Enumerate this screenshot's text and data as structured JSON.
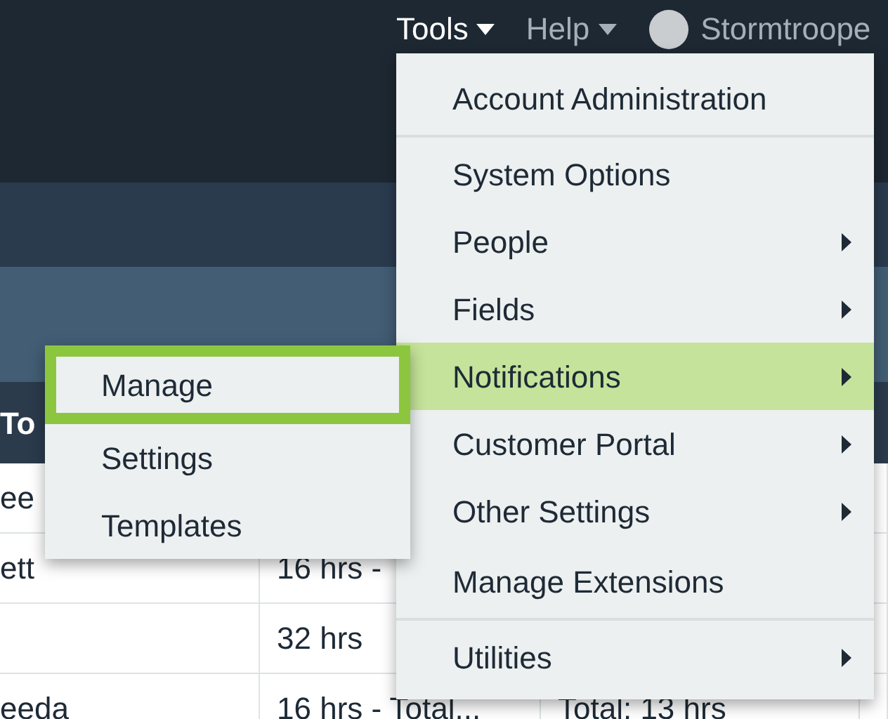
{
  "nav": {
    "items": [
      {
        "label": "Tools",
        "selected": true
      },
      {
        "label": "Help",
        "selected": false
      }
    ],
    "user": {
      "name": "Stormtroope"
    }
  },
  "table": {
    "columns": [
      "To"
    ],
    "rows": [
      [
        "ee",
        "",
        "",
        ""
      ],
      [
        "ett",
        "16 hrs -",
        "",
        ""
      ],
      [
        "",
        "32 hrs",
        "",
        ""
      ],
      [
        "eeda",
        "16 hrs - Total...",
        "Total: 13 hrs",
        ""
      ]
    ]
  },
  "tools_menu": {
    "items": [
      {
        "label": "Account Administration",
        "submenu": false,
        "divider_after": true,
        "selected": false
      },
      {
        "label": "System Options",
        "submenu": false,
        "divider_after": false,
        "selected": false
      },
      {
        "label": "People",
        "submenu": true,
        "divider_after": false,
        "selected": false
      },
      {
        "label": "Fields",
        "submenu": true,
        "divider_after": false,
        "selected": false
      },
      {
        "label": "Notifications",
        "submenu": true,
        "divider_after": false,
        "selected": true
      },
      {
        "label": "Customer Portal",
        "submenu": true,
        "divider_after": false,
        "selected": false
      },
      {
        "label": "Other Settings",
        "submenu": true,
        "divider_after": false,
        "selected": false
      },
      {
        "label": "Manage Extensions",
        "submenu": false,
        "divider_after": true,
        "selected": false
      },
      {
        "label": "Utilities",
        "submenu": true,
        "divider_after": false,
        "selected": false
      }
    ]
  },
  "submenu": {
    "items": [
      {
        "label": "Manage",
        "selected": true
      },
      {
        "label": "Settings",
        "selected": false
      },
      {
        "label": "Templates",
        "selected": false
      }
    ]
  }
}
